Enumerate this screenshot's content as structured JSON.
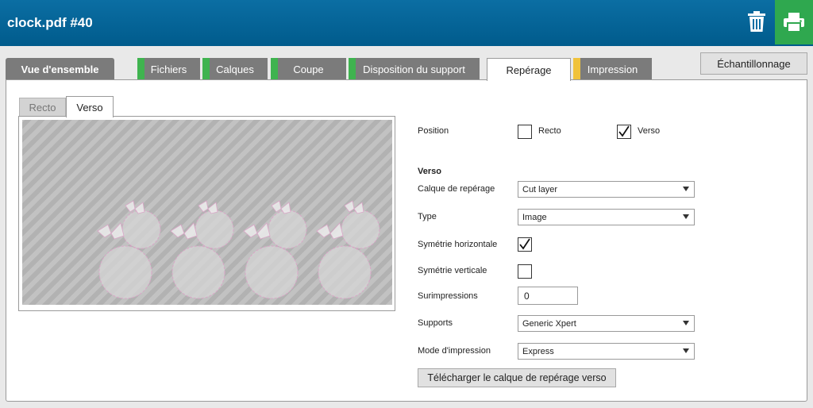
{
  "header": {
    "title": "clock.pdf #40",
    "trash_icon": "trash-icon",
    "print_icon": "printer-icon",
    "print_bg": "#2fa84f"
  },
  "sampling_label": "Échantillonnage",
  "tabs": [
    {
      "label": "Vue d'ensemble",
      "stripe": null,
      "active": false
    },
    {
      "label": "Fichiers",
      "stripe": "#3fb34f",
      "active": false
    },
    {
      "label": "Calques",
      "stripe": "#3fb34f",
      "active": false
    },
    {
      "label": "Coupe",
      "stripe": "#3fb34f",
      "active": false
    },
    {
      "label": "Disposition du support",
      "stripe": "#3fb34f",
      "active": false
    },
    {
      "label": "Repérage",
      "stripe": null,
      "active": true
    },
    {
      "label": "Impression",
      "stripe": "#f0c23b",
      "active": false
    }
  ],
  "preview": {
    "tab_recto": "Recto",
    "tab_verso": "Verso",
    "active_tab": "Verso"
  },
  "form": {
    "position_label": "Position",
    "recto_label": "Recto",
    "verso_label": "Verso",
    "recto_checked": false,
    "verso_checked": true,
    "section_title": "Verso",
    "layer_label": "Calque de repérage",
    "layer_value": "Cut layer",
    "type_label": "Type",
    "type_value": "Image",
    "sym_h_label": "Symétrie horizontale",
    "sym_h_checked": true,
    "sym_v_label": "Symétrie verticale",
    "sym_v_checked": false,
    "overprint_label": "Surimpressions",
    "overprint_value": "0",
    "media_label": "Supports",
    "media_value": "Generic Xpert",
    "print_mode_label": "Mode d'impression",
    "print_mode_value": "Express",
    "download_label": "Télécharger le calque de repérage verso"
  }
}
